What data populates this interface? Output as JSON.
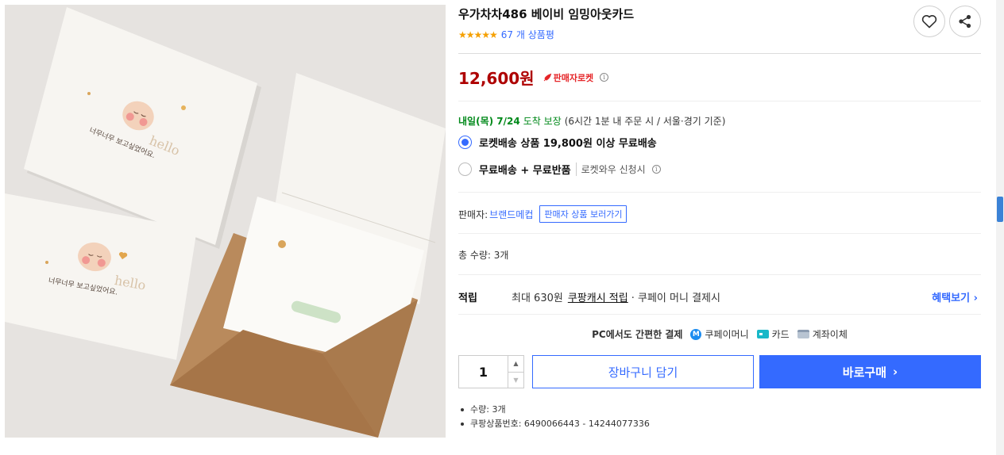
{
  "product": {
    "title": "우가차차486 베이비 임밍아웃카드",
    "stars": "★★★★★",
    "review_count": "67 개 상품평",
    "rating": 5
  },
  "actions": {
    "wishlist_icon": "heart-icon",
    "share_icon": "share-icon"
  },
  "price": {
    "amount": "12,600원",
    "badge": "판매자로켓",
    "info_icon": "i"
  },
  "delivery": {
    "date": "내일(목) 7/24",
    "guarantee": "도착 보장",
    "note": "(6시간 1분 내 주문 시 / 서울·경기 기준)",
    "options": [
      {
        "label": "로켓배송 상품 19,800원 이상 무료배송",
        "sub": "",
        "selected": true
      },
      {
        "label": "무료배송 + 무료반품",
        "sub": "로켓와우 신청시",
        "selected": false
      }
    ]
  },
  "seller": {
    "label": "판매자:",
    "name": "브랜드메컵",
    "button": "판매자 상품 보러가기"
  },
  "quantity_total": "총 수량: 3개",
  "reward": {
    "label": "적립",
    "text_prefix": "최대 630원",
    "cash_link": "쿠팡캐시 적립",
    "text_suffix": "· 쿠페이 머니 결제시",
    "benefit_link": "혜택보기 ›"
  },
  "payment": {
    "label": "PC에서도 간편한 결제",
    "coupay_glyph": "M",
    "methods": [
      "쿠페이머니",
      "카드",
      "계좌이체"
    ]
  },
  "purchase": {
    "quantity": "1",
    "cart_label": "장바구니 담기",
    "buy_label": "바로구매",
    "buy_chevron": "›"
  },
  "specs": [
    "수량: 3개",
    "쿠팡상품번호: 6490066443 - 14244077336"
  ],
  "photo": {
    "card_texts": [
      "너무너무 보고싶었어요.",
      "너무너무 보고싶었어요."
    ],
    "colors": {
      "background": "#e6e3e0",
      "card": "#f7f5f1",
      "envelope": "#b98a5c"
    }
  },
  "colors": {
    "accent": "#346aff",
    "price": "#ae0000",
    "delivery": "#00891a",
    "rocket": "#e52528",
    "stars": "#f5a000"
  }
}
